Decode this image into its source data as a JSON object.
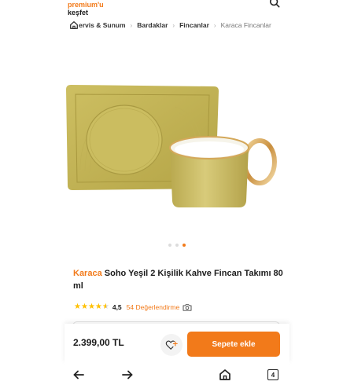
{
  "header": {
    "promo_line1": "premium'u",
    "promo_line2": "keşfet",
    "search_icon": "search-icon"
  },
  "breadcrumb": {
    "items": [
      "ervis & Sunum",
      "Bardaklar",
      "Fincanlar",
      "Karaca Fincanlar"
    ]
  },
  "gallery": {
    "dot_count": 3,
    "active_index": 2
  },
  "product": {
    "brand": "Karaca",
    "title": "Soho Yeşil 2 Kişilik Kahve Fincan Takımı 80 ml",
    "rating": "4,5",
    "rating_value": 4.5,
    "review_count": "54 Değerlendirme"
  },
  "buy_bar": {
    "price": "2.399,00 TL",
    "cart_label": "Sepete ekle"
  },
  "nav": {
    "tab_count": "4"
  },
  "colors": {
    "accent": "#f27a1a",
    "star": "#ffc000",
    "cup": "#c9b85a"
  }
}
